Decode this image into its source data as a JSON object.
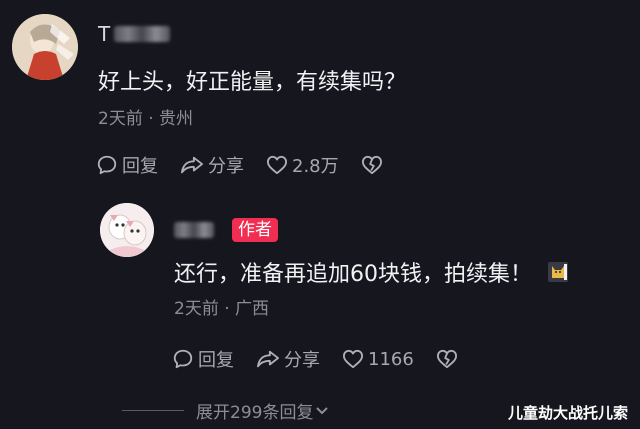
{
  "comment": {
    "username_initial": "T",
    "text": "好上头，好正能量，有续集吗？",
    "time": "2天前",
    "location": "贵州",
    "reply_label": "回复",
    "share_label": "分享",
    "like_count": "2.8万"
  },
  "reply": {
    "author_badge": "作者",
    "text": "还行，准备再追加60块钱，拍续集！",
    "time": "2天前",
    "location": "广西",
    "reply_label": "回复",
    "share_label": "分享",
    "like_count": "1166"
  },
  "expand": {
    "label": "展开299条回复"
  },
  "watermark": "儿童劫大战托儿索",
  "colors": {
    "background": "#16161e",
    "author_badge": "#f02e52",
    "text_primary": "#f2f2f4",
    "text_secondary": "#8d8d96"
  },
  "icons": [
    "reply-bubble-icon",
    "share-arrow-icon",
    "heart-icon",
    "broken-heart-icon",
    "chevron-down-icon",
    "cat-emoji-icon"
  ]
}
